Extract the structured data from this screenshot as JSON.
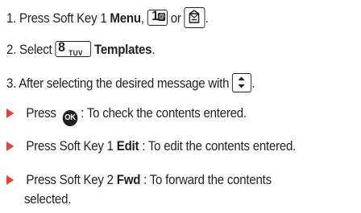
{
  "steps": [
    {
      "number": "1.",
      "text_before": "Press Soft Key 1",
      "bold": "Menu",
      "text_mid": ",",
      "text_or": "or",
      "text_after": ".",
      "key1_number": "1",
      "key1_symbol": "@"
    },
    {
      "number": "2.",
      "text_before": "Select",
      "key_number": "8",
      "key_letters": "TUV",
      "bold": "Templates",
      "text_after": "."
    },
    {
      "number": "3.",
      "text_before": "After selecting the desired message with",
      "text_after": "."
    }
  ],
  "bullets": [
    {
      "text_before": "Press",
      "ok_label": "OK",
      "text_after": ": To check the contents entered."
    },
    {
      "text_before": "Press Soft Key 1",
      "bold": "Edit",
      "text_after": ": To edit the contents entered."
    },
    {
      "text_before": "Press Soft Key 2",
      "bold": "Fwd",
      "text_after": ": To forward the contents",
      "continuation": "selected."
    }
  ],
  "colors": {
    "text": "#231f20",
    "bullet": "#e8403a"
  },
  "icons": {
    "key1": "key-1-at-icon",
    "message": "message-key-icon",
    "key8": "key-8-tuv-icon",
    "nav": "up-down-nav-key-icon",
    "ok": "ok-button-icon",
    "bullet": "red-triangle-bullet-icon"
  }
}
